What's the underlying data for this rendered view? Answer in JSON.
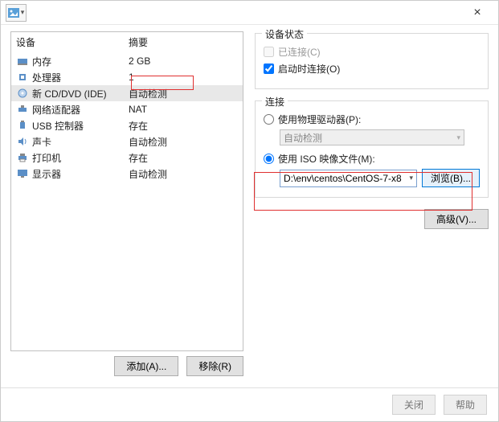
{
  "titlebar": {
    "close": "×"
  },
  "list": {
    "header_device": "设备",
    "header_summary": "摘要",
    "rows": [
      {
        "name": "内存",
        "summary": "2 GB",
        "icon": "memory"
      },
      {
        "name": "处理器",
        "summary": "1",
        "icon": "cpu"
      },
      {
        "name": "新 CD/DVD (IDE)",
        "summary": "自动检测",
        "icon": "cd",
        "selected": true
      },
      {
        "name": "网络适配器",
        "summary": "NAT",
        "icon": "net"
      },
      {
        "name": "USB 控制器",
        "summary": "存在",
        "icon": "usb"
      },
      {
        "name": "声卡",
        "summary": "自动检测",
        "icon": "sound"
      },
      {
        "name": "打印机",
        "summary": "存在",
        "icon": "printer"
      },
      {
        "name": "显示器",
        "summary": "自动检测",
        "icon": "display"
      }
    ]
  },
  "left_buttons": {
    "add": "添加(A)...",
    "remove": "移除(R)"
  },
  "status_group": {
    "title": "设备状态",
    "connected": "已连接(C)",
    "connect_on_start": "启动时连接(O)"
  },
  "connect_group": {
    "title": "连接",
    "use_physical": "使用物理驱动器(P):",
    "physical_combo": "自动检测",
    "use_iso": "使用 ISO 映像文件(M):",
    "iso_path": "D:\\env\\centos\\CentOS-7-x8",
    "browse": "浏览(B)..."
  },
  "advanced": "高级(V)...",
  "footer": {
    "close": "关闭",
    "help": "帮助"
  }
}
